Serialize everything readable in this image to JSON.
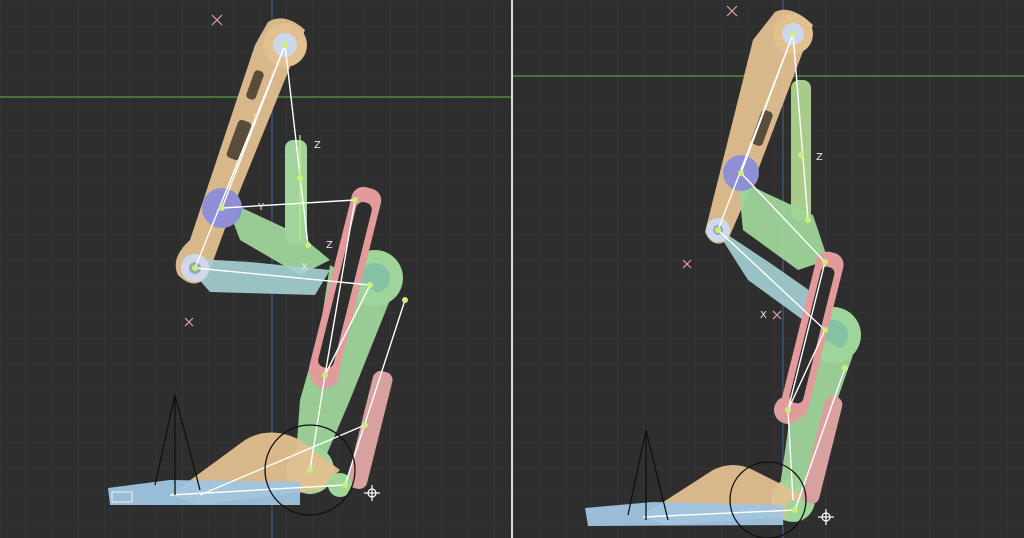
{
  "viewports": [
    {
      "name": "left",
      "axis_labels": [
        "X",
        "Y",
        "Z",
        "X",
        "Z",
        "X"
      ]
    },
    {
      "name": "right",
      "axis_labels": [
        "X",
        "Z",
        "X",
        "X"
      ]
    }
  ],
  "colors": {
    "background": "#2e2e2e",
    "grid_minor": "#3a3a3a",
    "grid_major": "#444444",
    "horizon_line": "#5c9a3a",
    "vertical_axis": "#3a5d8a",
    "thigh_link": "#e2c08f",
    "shin_link": "#9fd49a",
    "pink_link": "#e39a9a",
    "foot_blue": "#9fc4e0",
    "joint_purple": "#8f8fd8",
    "bone_line": "#ffffff",
    "bone_joint": "#c8f07a"
  },
  "icons": [
    "move-cursor-icon",
    "light-cone-icon"
  ]
}
